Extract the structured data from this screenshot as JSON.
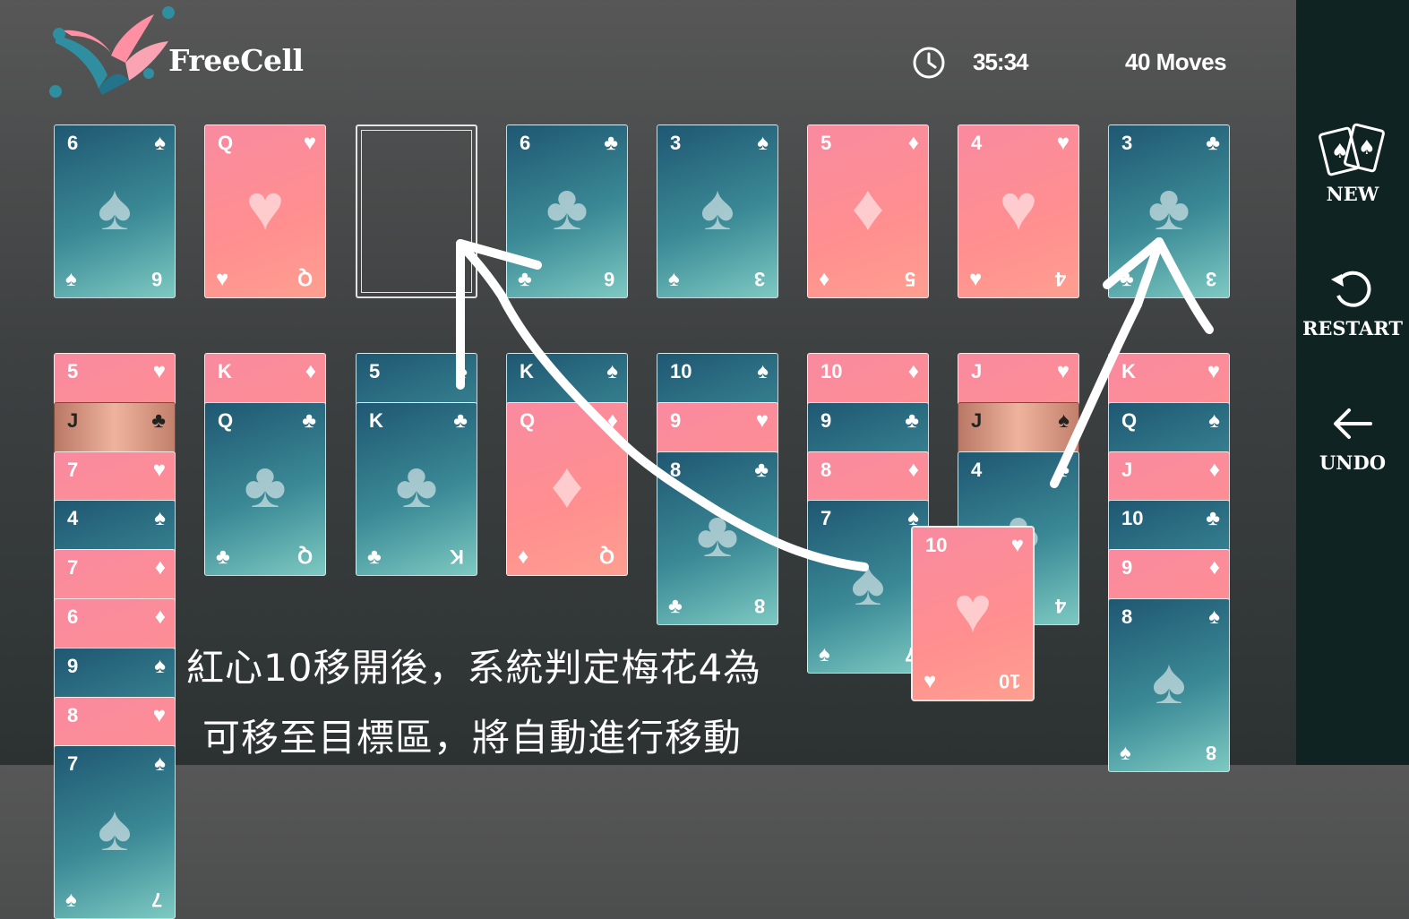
{
  "header": {
    "title": "FreeCell",
    "time": "35:34",
    "moves": "40 Moves"
  },
  "sidebar": {
    "new_label": "NEW",
    "restart_label": "RESTART",
    "undo_label": "UNDO"
  },
  "top_row": [
    {
      "rank": "6",
      "suit": "♠",
      "color": "black"
    },
    {
      "rank": "Q",
      "suit": "♥",
      "color": "red"
    },
    null,
    {
      "rank": "6",
      "suit": "♣",
      "color": "black"
    },
    {
      "rank": "3",
      "suit": "♠",
      "color": "black"
    },
    {
      "rank": "5",
      "suit": "♦",
      "color": "red"
    },
    {
      "rank": "4",
      "suit": "♥",
      "color": "red"
    },
    {
      "rank": "3",
      "suit": "♣",
      "color": "black"
    }
  ],
  "tableau": [
    [
      {
        "rank": "5",
        "suit": "♥",
        "color": "red"
      },
      {
        "rank": "J",
        "suit": "♣",
        "color": "gold"
      },
      {
        "rank": "7",
        "suit": "♥",
        "color": "red"
      },
      {
        "rank": "4",
        "suit": "♠",
        "color": "black"
      },
      {
        "rank": "7",
        "suit": "♦",
        "color": "red"
      },
      {
        "rank": "6",
        "suit": "♦",
        "color": "red"
      },
      {
        "rank": "9",
        "suit": "♠",
        "color": "black"
      },
      {
        "rank": "8",
        "suit": "♥",
        "color": "red"
      },
      {
        "rank": "7",
        "suit": "♠",
        "color": "black"
      }
    ],
    [
      {
        "rank": "K",
        "suit": "♦",
        "color": "red"
      },
      {
        "rank": "Q",
        "suit": "♣",
        "color": "black"
      }
    ],
    [
      {
        "rank": "5",
        "suit": "♠",
        "color": "black"
      },
      {
        "rank": "K",
        "suit": "♣",
        "color": "black"
      }
    ],
    [
      {
        "rank": "K",
        "suit": "♠",
        "color": "black"
      },
      {
        "rank": "Q",
        "suit": "♦",
        "color": "red"
      }
    ],
    [
      {
        "rank": "10",
        "suit": "♠",
        "color": "black"
      },
      {
        "rank": "9",
        "suit": "♥",
        "color": "red"
      },
      {
        "rank": "8",
        "suit": "♣",
        "color": "black"
      }
    ],
    [
      {
        "rank": "10",
        "suit": "♦",
        "color": "red"
      },
      {
        "rank": "9",
        "suit": "♣",
        "color": "black"
      },
      {
        "rank": "8",
        "suit": "♦",
        "color": "red"
      },
      {
        "rank": "7",
        "suit": "♠",
        "color": "black"
      }
    ],
    [
      {
        "rank": "J",
        "suit": "♥",
        "color": "red"
      },
      {
        "rank": "J",
        "suit": "♠",
        "color": "gold"
      },
      {
        "rank": "4",
        "suit": "♣",
        "color": "black"
      }
    ],
    [
      {
        "rank": "K",
        "suit": "♥",
        "color": "red"
      },
      {
        "rank": "Q",
        "suit": "♠",
        "color": "black"
      },
      {
        "rank": "J",
        "suit": "♦",
        "color": "red"
      },
      {
        "rank": "10",
        "suit": "♣",
        "color": "black"
      },
      {
        "rank": "9",
        "suit": "♦",
        "color": "red"
      },
      {
        "rank": "8",
        "suit": "♠",
        "color": "black"
      }
    ]
  ],
  "dragging_card": {
    "rank": "10",
    "suit": "♥",
    "color": "red"
  },
  "annotation": {
    "line1": "紅心10移開後，系統判定梅花4為",
    "line2": "可移至目標區，將自動進行移動"
  }
}
